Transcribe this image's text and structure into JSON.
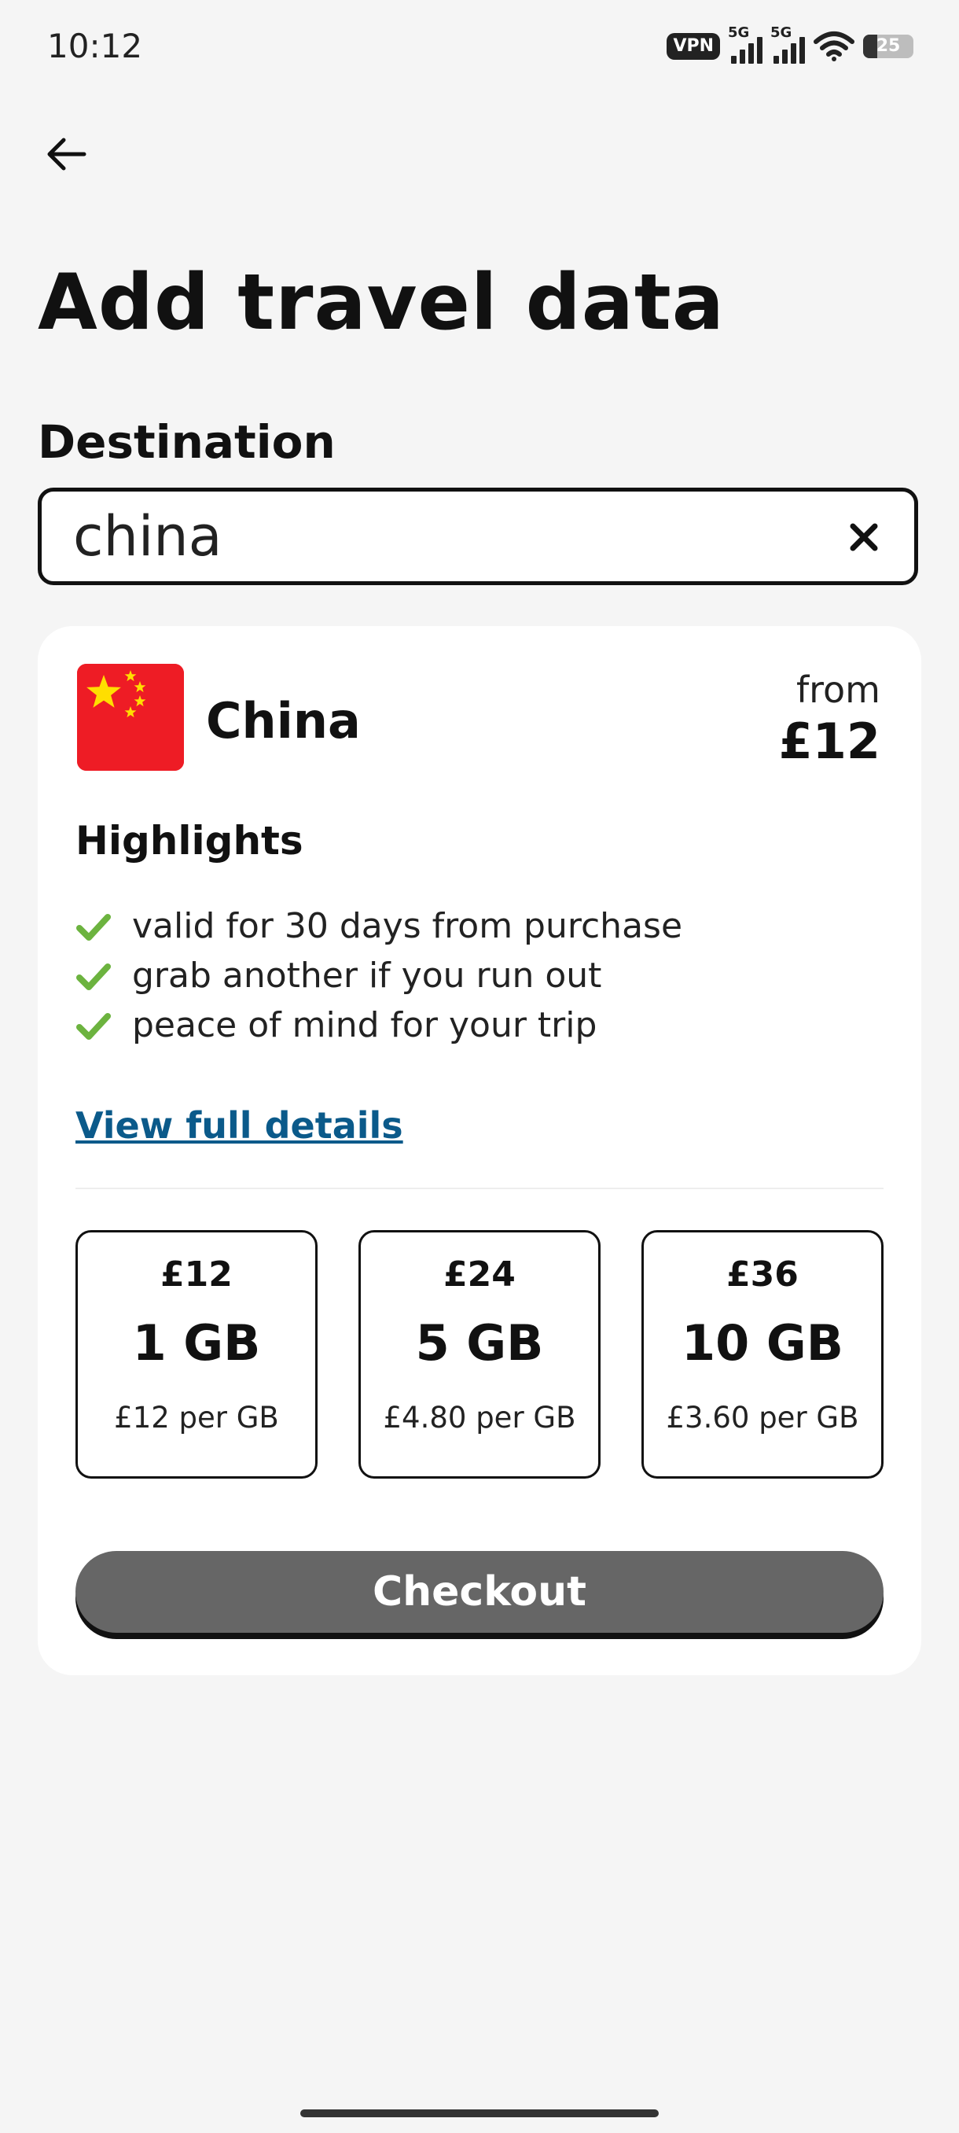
{
  "status_bar": {
    "time": "10:12",
    "vpn": "VPN",
    "sim1": "5G",
    "sim2": "5G",
    "battery": "25"
  },
  "header": {
    "title": "Add travel data"
  },
  "destination": {
    "label": "Destination",
    "value": "china"
  },
  "result": {
    "country": "China",
    "from_label": "from",
    "from_price": "£12",
    "highlights_title": "Highlights",
    "highlights": [
      "valid for 30 days from purchase",
      "grab another if you run out",
      "peace of mind for your trip"
    ],
    "details_link": "View full details",
    "plans": [
      {
        "price": "£12",
        "size": "1 GB",
        "rate": "£12 per GB"
      },
      {
        "price": "£24",
        "size": "5 GB",
        "rate": "£4.80 per GB"
      },
      {
        "price": "£36",
        "size": "10 GB",
        "rate": "£3.60 per GB"
      }
    ],
    "checkout_label": "Checkout"
  },
  "colors": {
    "background": "#f5f5f5",
    "card": "#ffffff",
    "link": "#0b5a8a",
    "check": "#6cb33f",
    "checkout_bg": "#666666",
    "flag_red": "#ee1c25",
    "flag_yellow": "#ffde00"
  }
}
